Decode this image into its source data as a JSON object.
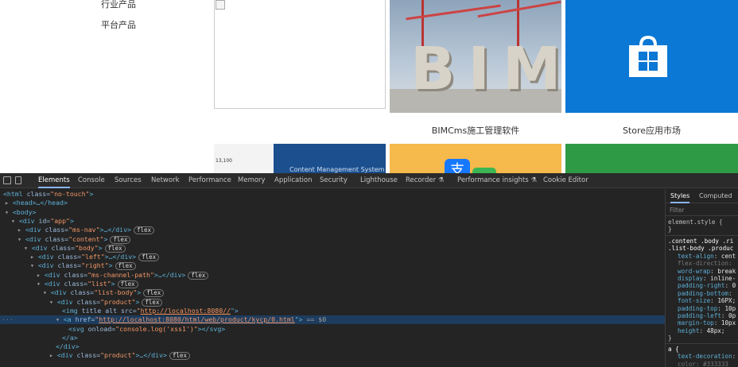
{
  "page": {
    "side_nav": [
      "行业产品",
      "平台产品"
    ],
    "captions": {
      "bim": "BIMCms施工管理软件",
      "store": "Store应用市场"
    },
    "bim_letters": "BIM",
    "thumb1_text": "13,100",
    "thumb2_text": "Content Management System",
    "alipay_glyph": "支"
  },
  "devtools": {
    "tabs": [
      "Elements",
      "Console",
      "Sources",
      "Network",
      "Performance",
      "Memory",
      "Application",
      "Security",
      "Lighthouse",
      "Recorder ⚗",
      "Performance insights ⚗",
      "Cookie Editor"
    ],
    "active_tab": "Elements",
    "dom": {
      "l1": {
        "tag": "<html",
        "attr": " class=",
        "val": "\"no-touch\"",
        "close": ">"
      },
      "l2": "<head>…</head>",
      "l3": "<body>",
      "l4": {
        "tag": "<div",
        "attr": " id=",
        "val": "\"app\"",
        "close": ">"
      },
      "l5": {
        "tag": "<div",
        "attr": " class=",
        "val": "\"ms-nav\"",
        "close": ">…</div>"
      },
      "l6": {
        "tag": "<div",
        "attr": " class=",
        "val": "\"content\"",
        "close": ">"
      },
      "l7": {
        "tag": "<div",
        "attr": " class=",
        "val": "\"body\"",
        "close": ">"
      },
      "l8": {
        "tag": "<div",
        "attr": " class=",
        "val": "\"left\"",
        "close": ">…</div>"
      },
      "l9": {
        "tag": "<div",
        "attr": " class=",
        "val": "\"right\"",
        "close": ">"
      },
      "l10": {
        "tag": "<div",
        "attr": " class=",
        "val": "\"ms-channel-path\"",
        "close": ">…</div>"
      },
      "l11": {
        "tag": "<div",
        "attr": " class=",
        "val": "\"list\"",
        "close": ">"
      },
      "l12": {
        "tag": "<div",
        "attr": " class=",
        "val": "\"list-body\"",
        "close": ">"
      },
      "l13": {
        "tag": "<div",
        "attr": " class=",
        "val": "\"product\"",
        "close": ">"
      },
      "l14": {
        "tag": "<img",
        "attr": " title alt src=",
        "q": "\"",
        "link": "http://localhost:8080//",
        "close": "\">"
      },
      "l15": {
        "tag": "<a",
        "attr": " href=",
        "q": "\"",
        "link": "http://localhost:8080/html/web/product/kycp/0.html",
        "close": "\">",
        "marker": " == $0"
      },
      "l16": {
        "tag": "<svg",
        "attr": " onload=",
        "val": "\"console.log('xss1')\"",
        "close": "></svg>"
      },
      "l17": "</a>",
      "l18": "</div>",
      "l19": {
        "tag": "<div",
        "attr": " class=",
        "val": "\"product\"",
        "close": ">…</div>"
      },
      "flex_badge": "flex",
      "dots": "···"
    },
    "styles_panel": {
      "tabs": [
        "Styles",
        "Computed"
      ],
      "filter_placeholder": "Filter",
      "element_style": "element.style {",
      "brace_close": "}",
      "selector1": ".content .body .ri",
      "selector2": ".list-body .produc",
      "props": [
        {
          "name": "text-align",
          "value": "cent"
        },
        {
          "name": "flex-direction",
          "value": ""
        },
        {
          "name": "word-wrap",
          "value": "break"
        },
        {
          "name": "display",
          "value": "inline-"
        },
        {
          "name": "padding-right",
          "value": "0"
        },
        {
          "name": "padding-bottom",
          "value": ""
        },
        {
          "name": "font-size",
          "value": "16PX;"
        },
        {
          "name": "padding-top",
          "value": "10p"
        },
        {
          "name": "padding-left",
          "value": "0p"
        },
        {
          "name": "margin-top",
          "value": "10px"
        },
        {
          "name": "height",
          "value": "48px;"
        }
      ],
      "a_rule": "a {",
      "a_prop": {
        "name": "text-decoration",
        "value": ""
      },
      "a_cut": "color: #333333"
    }
  },
  "colors": {
    "accent": "#8ab4f8",
    "store_blue": "#0a78d4",
    "devtools_bg": "#242424"
  }
}
